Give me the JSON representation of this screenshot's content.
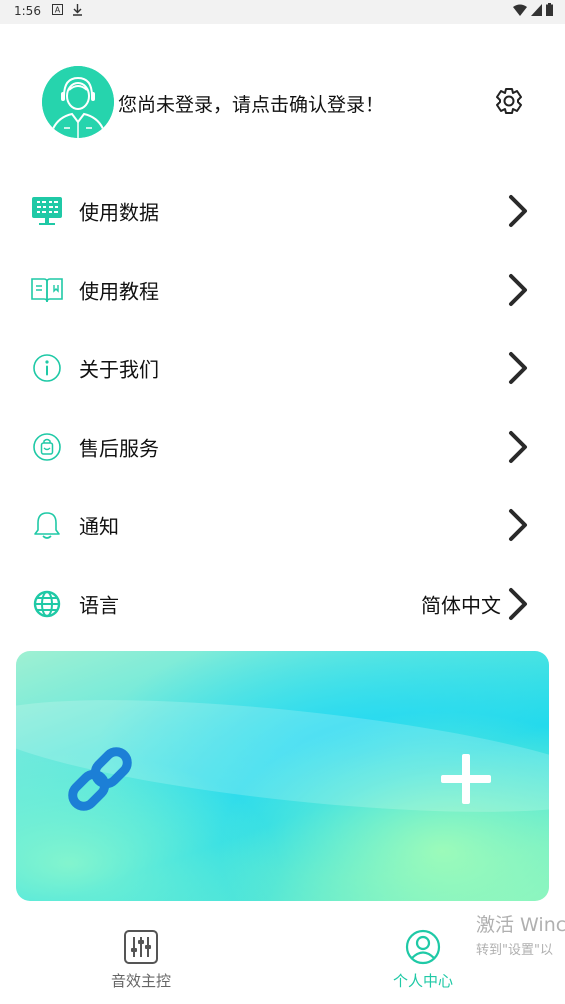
{
  "status_bar": {
    "time": "1:56"
  },
  "profile": {
    "login_prompt": "您尚未登录，请点击确认登录！"
  },
  "menu": {
    "items": [
      {
        "label": "使用数据",
        "icon": "monitor-data-icon"
      },
      {
        "label": "使用教程",
        "icon": "book-icon"
      },
      {
        "label": "关于我们",
        "icon": "info-icon"
      },
      {
        "label": "售后服务",
        "icon": "service-bag-icon"
      },
      {
        "label": "通知",
        "icon": "bell-icon"
      },
      {
        "label": "语言",
        "icon": "globe-icon",
        "value": "简体中文"
      }
    ]
  },
  "banner": {
    "left_icon": "link-icon",
    "right_icon": "plus-icon"
  },
  "bottom_nav": {
    "tabs": [
      {
        "label": "音效主控",
        "icon": "equalizer-icon",
        "active": false
      },
      {
        "label": "个人中心",
        "icon": "user-circle-icon",
        "active": true
      }
    ]
  },
  "watermark": {
    "line1": "激活 Winc",
    "line2": "转到\"设置\"以"
  },
  "colors": {
    "accent": "#1fc9a6",
    "banner_link": "#1c7fd6"
  }
}
